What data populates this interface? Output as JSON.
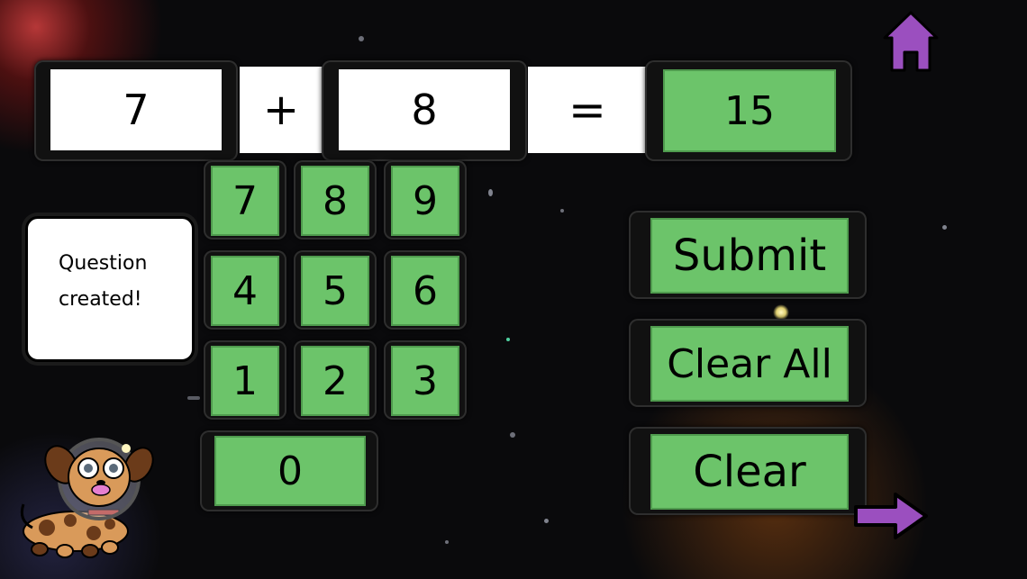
{
  "equation": {
    "operand1": "7",
    "operator": "+",
    "operand2": "8",
    "equals": "=",
    "answer": "15"
  },
  "keypad": {
    "row1": [
      "7",
      "8",
      "9"
    ],
    "row2": [
      "4",
      "5",
      "6"
    ],
    "row3": [
      "1",
      "2",
      "3"
    ],
    "zero": "0"
  },
  "message": {
    "line1": "Question",
    "line2": "created!"
  },
  "actions": {
    "submit": "Submit",
    "clear_all": "Clear All",
    "clear": "Clear"
  },
  "icons": {
    "home": "home-icon",
    "next": "arrow-right-icon",
    "mascot": "astronaut-dog"
  },
  "colors": {
    "key_green": "#6cc46a",
    "icon_purple": "#9b4fbf"
  }
}
